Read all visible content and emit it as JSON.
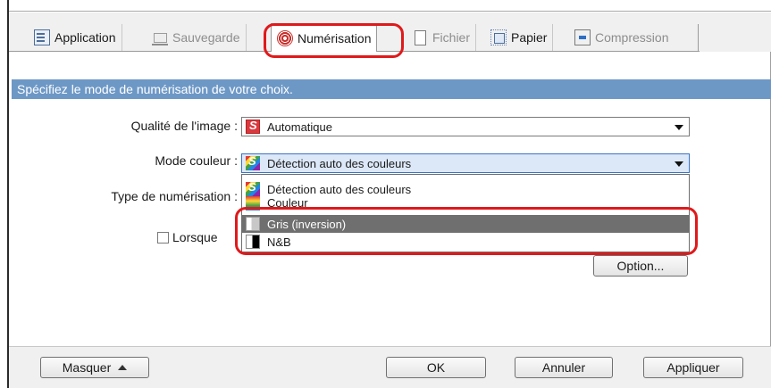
{
  "tabs": [
    {
      "label": "Application",
      "state": "enabled",
      "icon": "application-icon"
    },
    {
      "label": "Sauvegarde",
      "state": "disabled",
      "icon": "save-icon"
    },
    {
      "label": "Numérisation",
      "state": "active",
      "icon": "scan-icon"
    },
    {
      "label": "Fichier",
      "state": "disabled",
      "icon": "file-icon"
    },
    {
      "label": "Papier",
      "state": "enabled",
      "icon": "paper-icon"
    },
    {
      "label": "Compression",
      "state": "disabled",
      "icon": "compression-icon"
    }
  ],
  "banner": {
    "text": "Spécifiez le mode de numérisation de votre choix."
  },
  "form": {
    "image_quality": {
      "label": "Qualité de l'image :",
      "value": "Automatique",
      "icon": "auto-quality-icon"
    },
    "color_mode": {
      "label": "Mode couleur :",
      "value": "Détection auto des couleurs",
      "icon": "color-auto-icon",
      "options": [
        {
          "label": "Détection auto des couleurs",
          "icon": "color-auto-icon"
        },
        {
          "label": "Couleur",
          "icon": "color-icon"
        },
        {
          "label": "Gris (inversion)",
          "icon": "gray-inversion-icon",
          "selected": true
        },
        {
          "label": "N&B",
          "icon": "black-white-icon"
        }
      ]
    },
    "scan_type": {
      "label": "Type de numérisation :"
    },
    "checkbox": {
      "label": "Lorsque",
      "checked": false
    }
  },
  "option_button": {
    "label": "Option..."
  },
  "footer": {
    "hide_label": "Masquer",
    "ok_label": "OK",
    "cancel_label": "Annuler",
    "apply_label": "Appliquer"
  },
  "colors": {
    "banner": "#6d98c6",
    "highlight": "#e0191b",
    "selected_item": "#6f6f6f",
    "focused_combo": "#dce8f7"
  }
}
